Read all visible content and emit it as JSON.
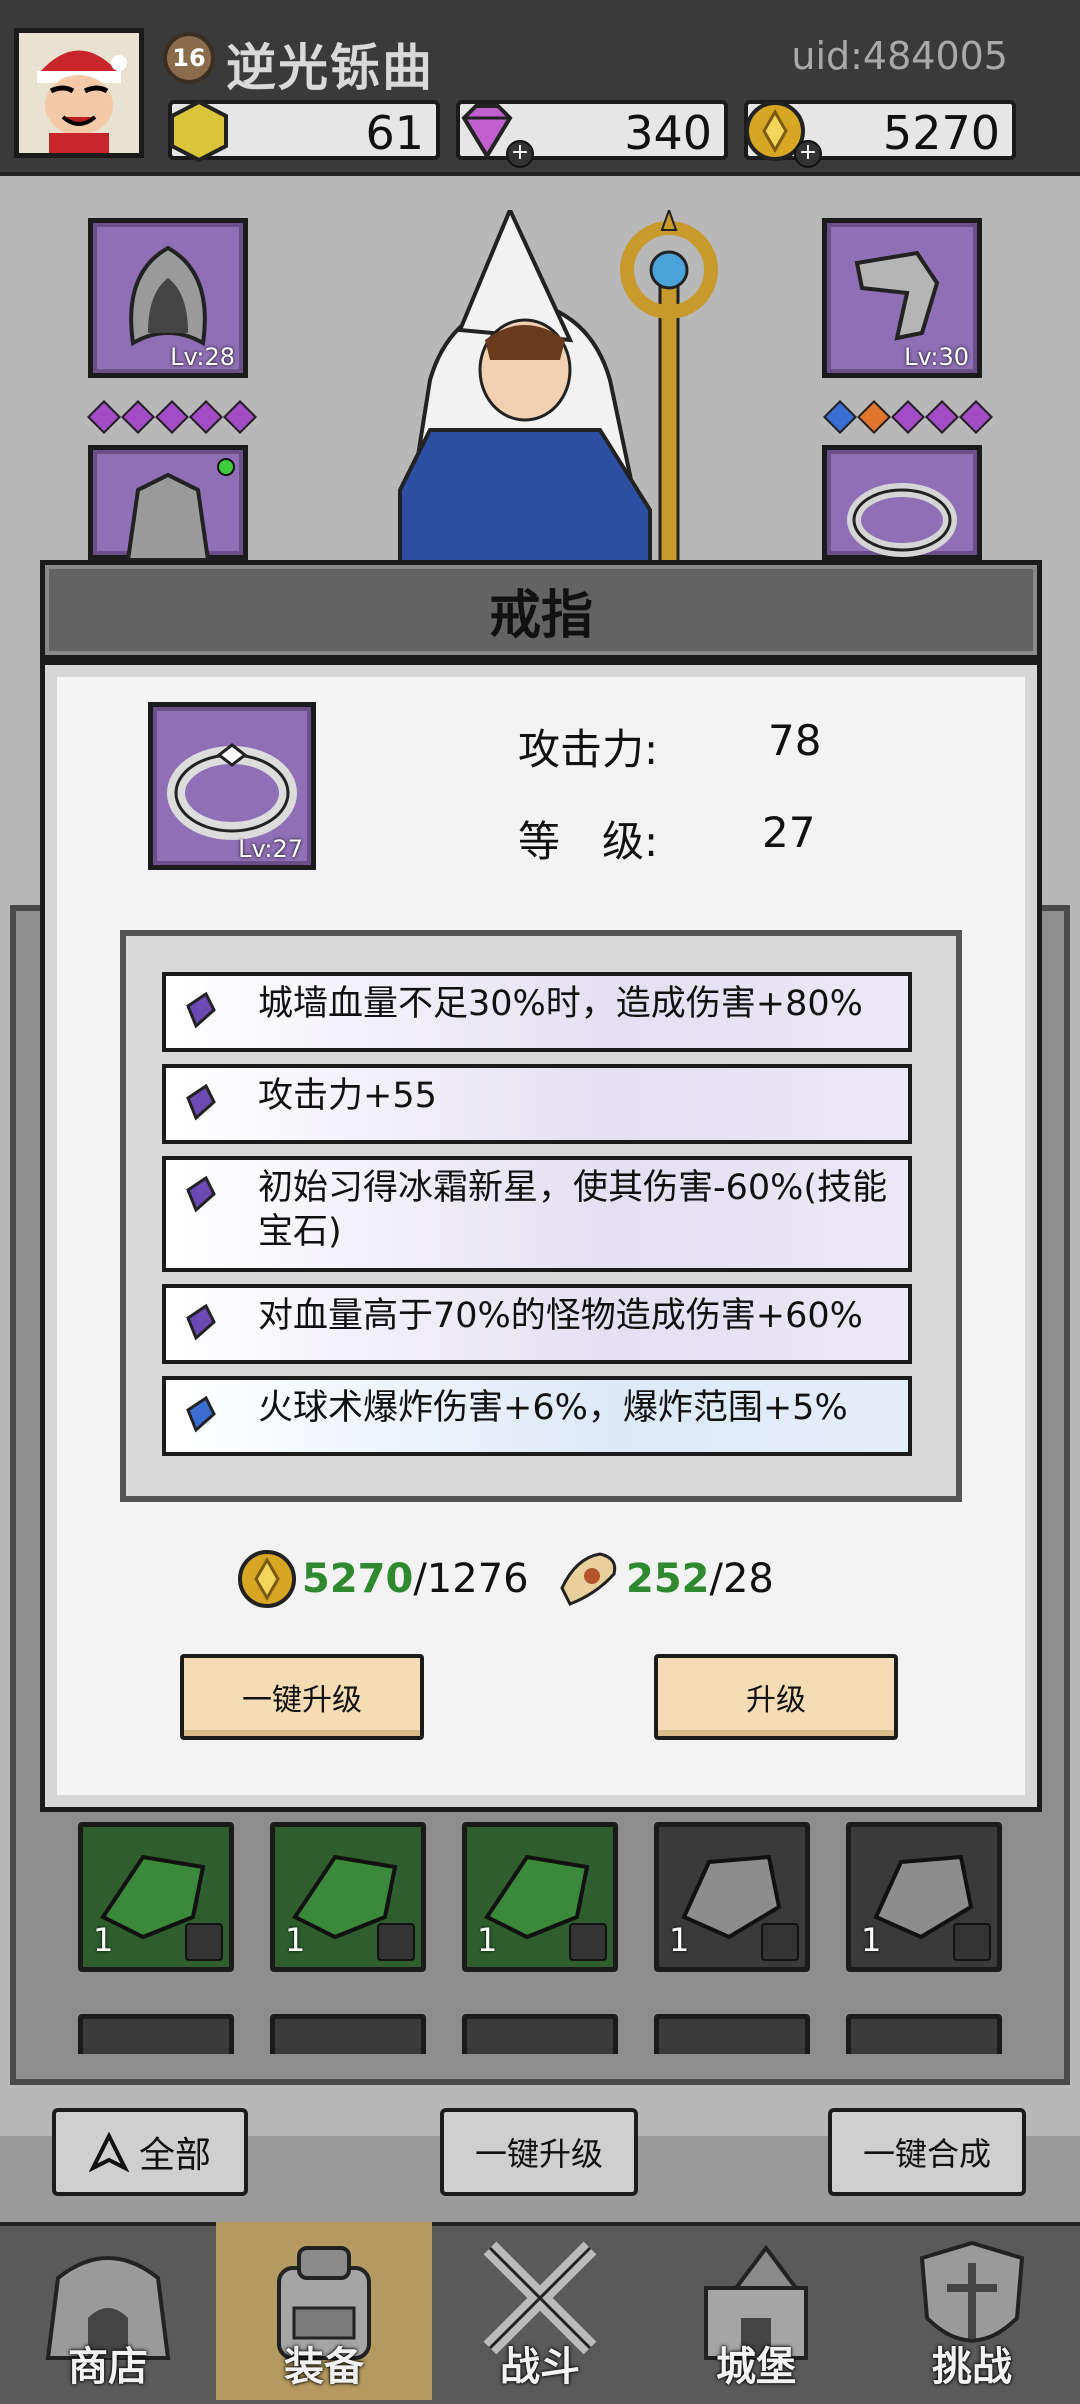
{
  "player": {
    "level": "16",
    "name": "逆光铄曲",
    "uid": "uid:484005"
  },
  "resources": {
    "gold_bar": "61",
    "gems": "340",
    "coins": "5270"
  },
  "equipment_slots": {
    "helmet_level": "Lv:28",
    "weapon_level": "Lv:30"
  },
  "modal": {
    "title": "戒指",
    "item_level": "Lv:27",
    "attack_label": "攻击力:",
    "attack_value": "78",
    "level_label": "等　级:",
    "level_value": "27",
    "affixes": [
      {
        "text": "城墙血量不足30%时，造成伤害+80%",
        "gem_color": "#6b4bb3"
      },
      {
        "text": "攻击力+55",
        "gem_color": "#6b4bb3"
      },
      {
        "text": "初始习得冰霜新星，使其伤害-60%(技能宝石)",
        "gem_color": "#6b4bb3"
      },
      {
        "text": "对血量高于70%的怪物造成伤害+60%",
        "gem_color": "#6b4bb3"
      },
      {
        "text": "火球术爆炸伤害+6%，爆炸范围+5%",
        "gem_color": "#3a6ed0"
      }
    ],
    "gold_have": "5270",
    "gold_need": "/1276",
    "scroll_have": "252",
    "scroll_need": "/28",
    "btn_upgrade_all": "一键升级",
    "btn_upgrade": "升级"
  },
  "inventory": {
    "items": [
      {
        "count": "1",
        "type": "green-gem"
      },
      {
        "count": "1",
        "type": "green-gem"
      },
      {
        "count": "1",
        "type": "green-gem"
      },
      {
        "count": "1",
        "type": "gray-stone"
      },
      {
        "count": "1",
        "type": "gray-stone"
      }
    ]
  },
  "footer_buttons": {
    "filter": "全部",
    "upgrade_all": "一键升级",
    "merge_all": "一键合成"
  },
  "nav": {
    "shop": "商店",
    "equipment": "装备",
    "battle": "战斗",
    "castle": "城堡",
    "challenge": "挑战"
  },
  "colors": {
    "accent_green": "#2f8a2f",
    "slot_purple": "#8f6fb5",
    "button_tan": "#f5dcb4"
  }
}
